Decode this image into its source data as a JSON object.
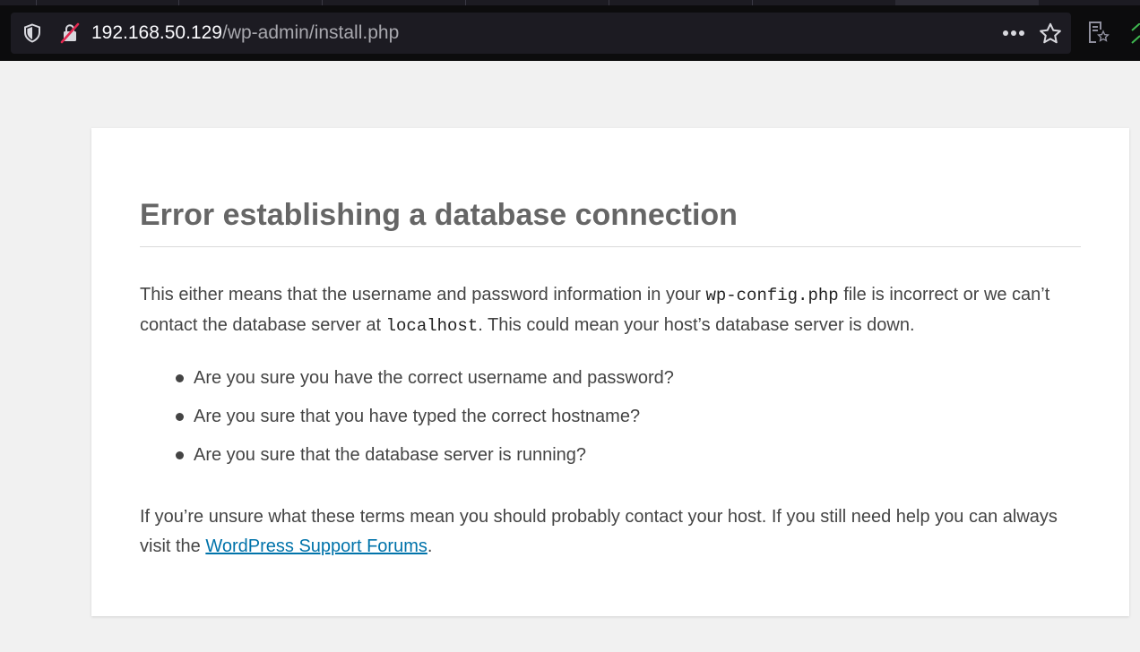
{
  "browser": {
    "url_host": "192.168.50.129",
    "url_path": "/wp-admin/install.php",
    "icons": {
      "tracking_protection": "shield-icon",
      "connection": "insecure-lock-icon",
      "page_actions": "more-icon",
      "bookmark": "star-icon",
      "reader_view": "reader-view-icon"
    }
  },
  "page": {
    "title": "Error establishing a database connection",
    "intro": {
      "part1": "This either means that the username and password information in your ",
      "code1": "wp-config.php",
      "part2": " file is incorrect or we can’t contact the database server at ",
      "code2": "localhost",
      "part3": ". This could mean your host’s database server is down."
    },
    "checks": [
      "Are you sure you have the correct username and password?",
      "Are you sure that you have typed the correct hostname?",
      "Are you sure that the database server is running?"
    ],
    "footer": {
      "part1": "If you’re unsure what these terms mean you should probably contact your host. If you still need help you can always visit the ",
      "link": "WordPress Support Forums",
      "part2": "."
    }
  },
  "colors": {
    "chrome_bg": "#0c0c0d",
    "urlbar_bg": "#1c1b22",
    "page_bg": "#f1f1f1",
    "title": "#666666",
    "text": "#444444",
    "link": "#0073aa"
  }
}
